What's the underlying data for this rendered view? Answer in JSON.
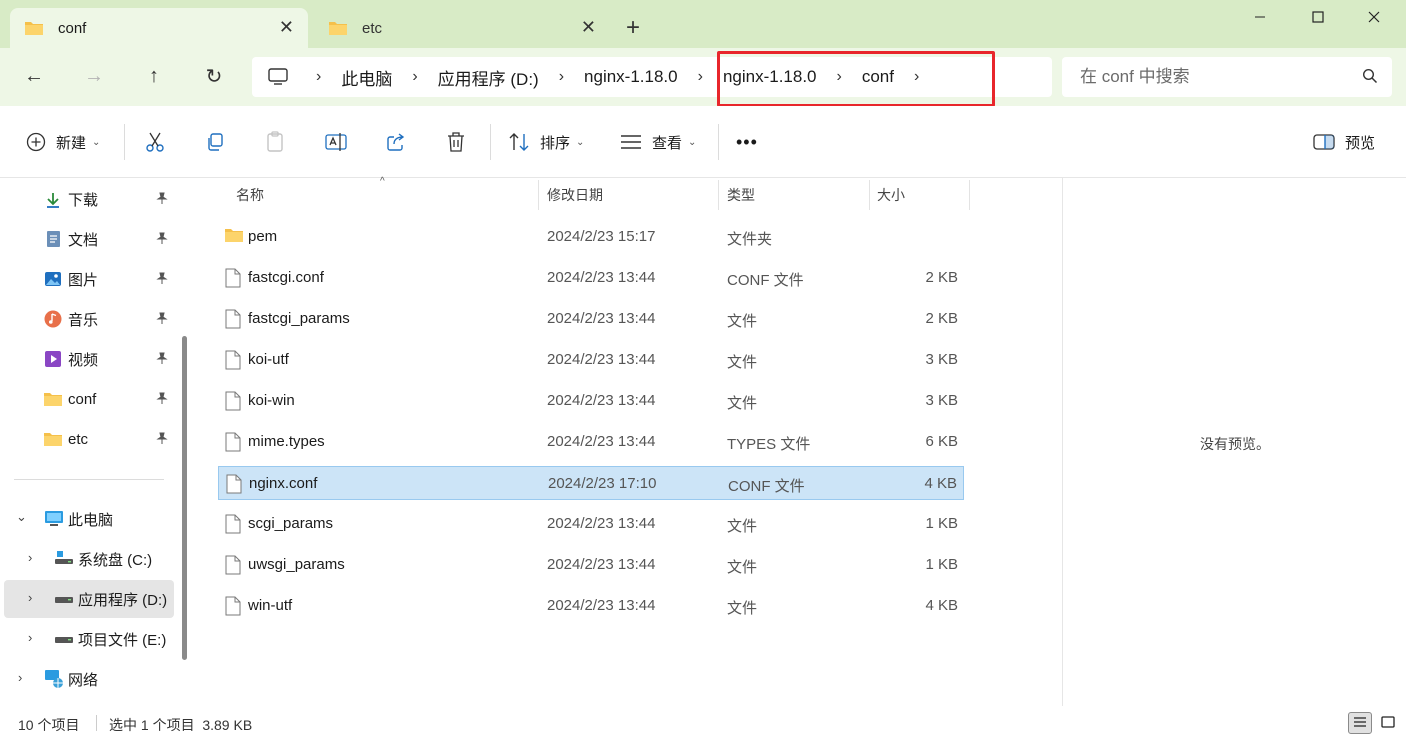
{
  "tabs": [
    {
      "label": "conf",
      "close": "✕"
    },
    {
      "label": "etc",
      "close": "✕"
    }
  ],
  "new_tab": "+",
  "window": {
    "minimize": "—",
    "maximize": "☐",
    "close": "✕"
  },
  "nav": {
    "back": "←",
    "forward": "→",
    "up": "↑",
    "refresh": "↻"
  },
  "breadcrumbs": [
    "此电脑",
    "应用程序 (D:)",
    "nginx-1.18.0",
    "nginx-1.18.0",
    "conf"
  ],
  "breadcrumb_sep": "›",
  "search": {
    "placeholder": "在 conf 中搜索"
  },
  "toolbar": {
    "new_label": "新建",
    "sort_label": "排序",
    "view_label": "查看",
    "more_label": "•••",
    "preview_label": "预览"
  },
  "sidebar": {
    "quick": [
      {
        "label": "下载",
        "icon": "download-icon"
      },
      {
        "label": "文档",
        "icon": "document-icon"
      },
      {
        "label": "图片",
        "icon": "pictures-icon"
      },
      {
        "label": "音乐",
        "icon": "music-icon"
      },
      {
        "label": "视频",
        "icon": "video-icon"
      },
      {
        "label": "conf",
        "icon": "folder-icon"
      },
      {
        "label": "etc",
        "icon": "folder-icon"
      }
    ],
    "pin": "📌",
    "this_pc": "此电脑",
    "drives": [
      "系统盘 (C:)",
      "应用程序 (D:)",
      "项目文件 (E:)"
    ],
    "network": "网络",
    "expanded": "⌄",
    "collapsed": "›"
  },
  "columns": {
    "name": "名称",
    "date": "修改日期",
    "type": "类型",
    "size": "大小"
  },
  "files": [
    {
      "name": "pem",
      "date": "2024/2/23 15:17",
      "type": "文件夹",
      "size": "",
      "kind": "folder"
    },
    {
      "name": "fastcgi.conf",
      "date": "2024/2/23 13:44",
      "type": "CONF 文件",
      "size": "2 KB",
      "kind": "file"
    },
    {
      "name": "fastcgi_params",
      "date": "2024/2/23 13:44",
      "type": "文件",
      "size": "2 KB",
      "kind": "file"
    },
    {
      "name": "koi-utf",
      "date": "2024/2/23 13:44",
      "type": "文件",
      "size": "3 KB",
      "kind": "file"
    },
    {
      "name": "koi-win",
      "date": "2024/2/23 13:44",
      "type": "文件",
      "size": "3 KB",
      "kind": "file"
    },
    {
      "name": "mime.types",
      "date": "2024/2/23 13:44",
      "type": "TYPES 文件",
      "size": "6 KB",
      "kind": "file"
    },
    {
      "name": "nginx.conf",
      "date": "2024/2/23 17:10",
      "type": "CONF 文件",
      "size": "4 KB",
      "kind": "file",
      "selected": true
    },
    {
      "name": "scgi_params",
      "date": "2024/2/23 13:44",
      "type": "文件",
      "size": "1 KB",
      "kind": "file"
    },
    {
      "name": "uwsgi_params",
      "date": "2024/2/23 13:44",
      "type": "文件",
      "size": "1 KB",
      "kind": "file"
    },
    {
      "name": "win-utf",
      "date": "2024/2/23 13:44",
      "type": "文件",
      "size": "4 KB",
      "kind": "file"
    }
  ],
  "preview": {
    "empty_text": "没有预览。"
  },
  "status": {
    "count": "10 个项目",
    "selection": "选中 1 个项目  3.89 KB"
  },
  "colors": {
    "accent": "#cce4f7",
    "titlebar": "#d8ebc6",
    "highlight": "#e8262b",
    "folder": "#f5c04a"
  }
}
